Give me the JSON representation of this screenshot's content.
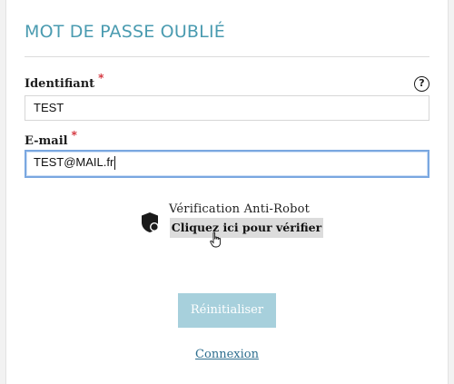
{
  "form": {
    "title": "MOT DE PASSE OUBLIÉ",
    "required_marker": "*",
    "identifier": {
      "label": "Identifiant",
      "value": "TEST",
      "help_icon": "question-circle-icon",
      "help_glyph": "?"
    },
    "email": {
      "label": "E-mail",
      "value": "TEST@MAIL.fr"
    },
    "captcha": {
      "title": "Vérification Anti-Robot",
      "button_label": "Cliquez ici pour vérifier",
      "icon": "shield-icon"
    },
    "reset_label": "Réinitialiser",
    "login_link": "Connexion"
  },
  "colors": {
    "title": "#4a9bb0",
    "required": "#d0202a",
    "reset_button": "#a7d0dc",
    "link": "#2f6f8f",
    "focus_border": "#7aa7e0"
  }
}
